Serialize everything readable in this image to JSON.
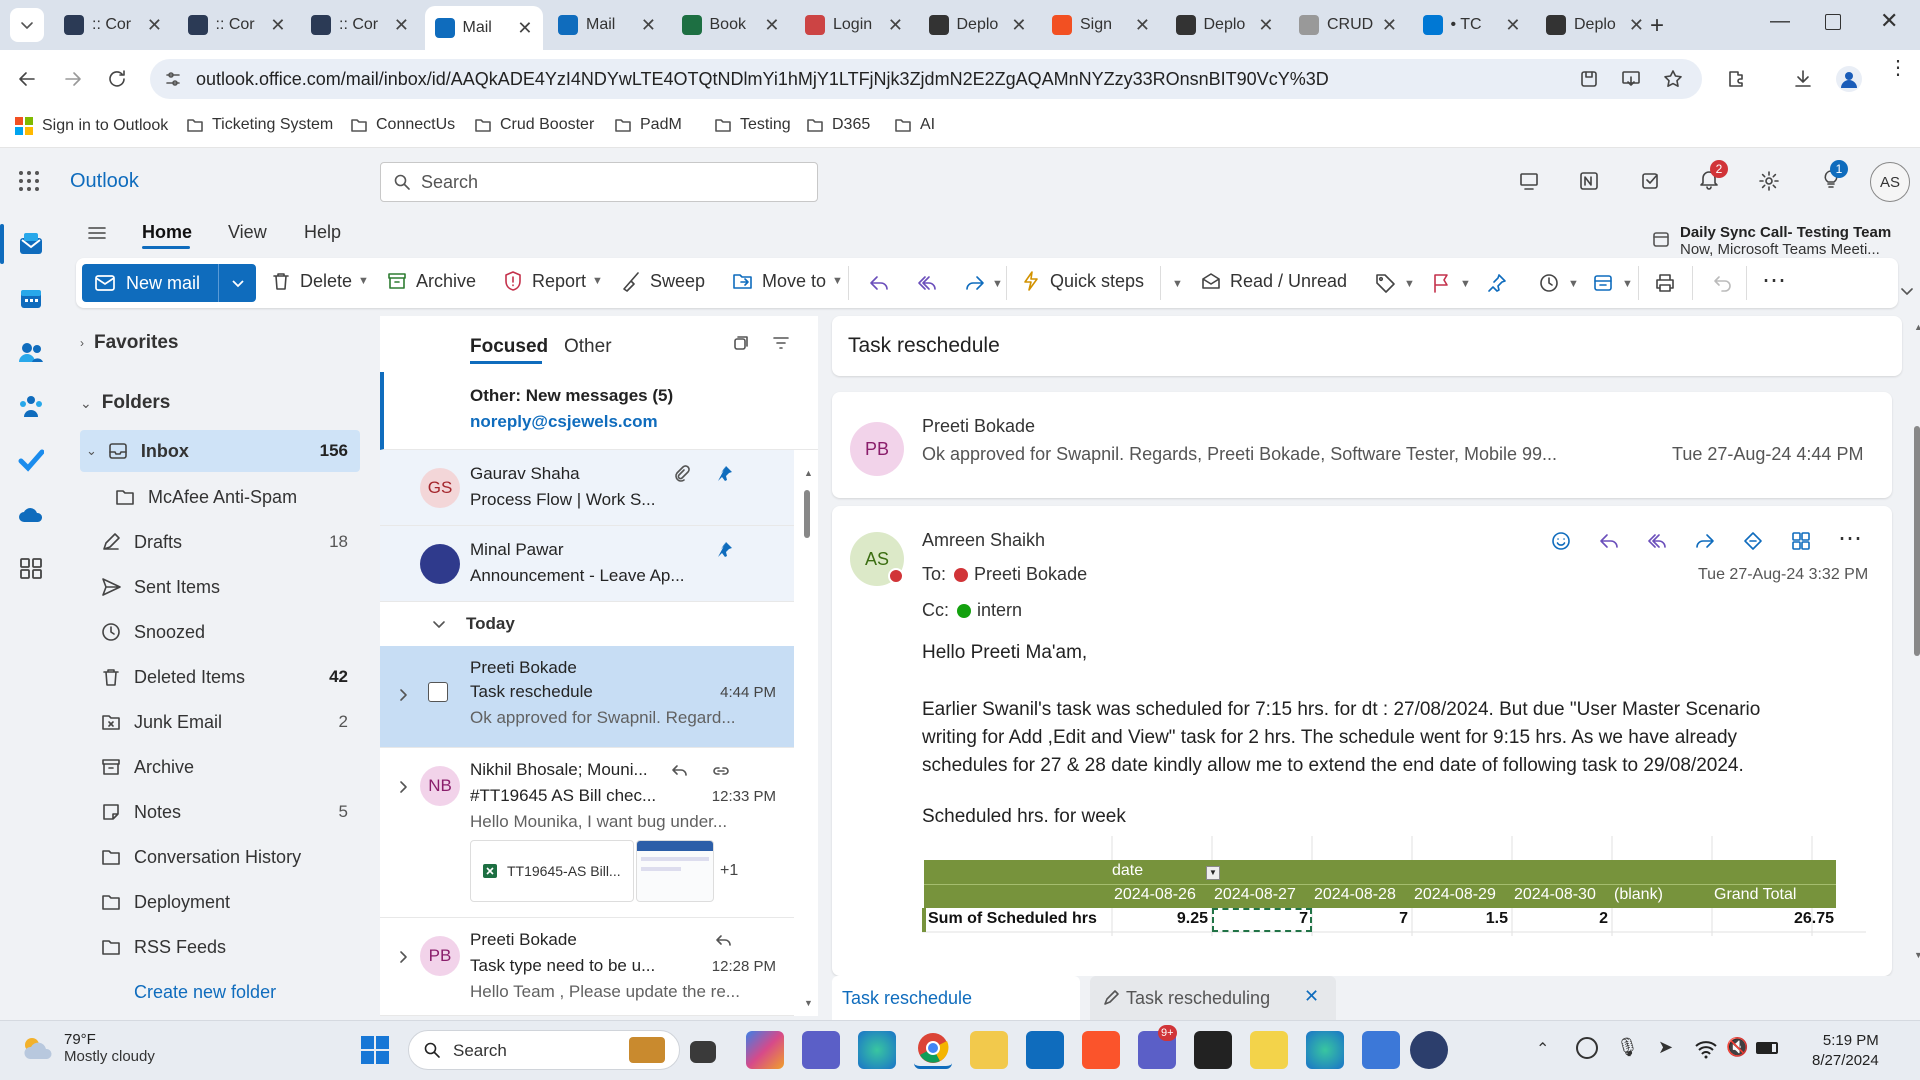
{
  "browser": {
    "tabs": [
      {
        "title": ":: Cor",
        "color": "#2b3a55"
      },
      {
        "title": ":: Cor",
        "color": "#2b3a55"
      },
      {
        "title": ":: Cor",
        "color": "#2b3a55"
      },
      {
        "title": "Mail",
        "color": "#0f6cbd",
        "active": true
      },
      {
        "title": "Mail",
        "color": "#0f6cbd"
      },
      {
        "title": "Book",
        "color": "#1d6f42"
      },
      {
        "title": "Login",
        "color": "#c44"
      },
      {
        "title": "Deplo",
        "color": "#333"
      },
      {
        "title": "Sign",
        "color": "#f25022"
      },
      {
        "title": "Deplo",
        "color": "#333"
      },
      {
        "title": "CRUD",
        "color": "#999"
      },
      {
        "title": "• TC",
        "color": "#0078d4"
      },
      {
        "title": "Deplo",
        "color": "#333"
      }
    ],
    "url": "outlook.office.com/mail/inbox/id/AAQkADE4YzI4NDYwLTE4OTQtNDlmYi1hMjY1LTFjNjk3ZjdmN2E2ZgAQAMnNYZzy33ROnsnBIT90VcY%3D",
    "bookmarks": [
      "Sign in to Outlook",
      "Ticketing System",
      "ConnectUs",
      "Crud Booster",
      "PadM",
      "Testing",
      "D365",
      "AI"
    ]
  },
  "outlook": {
    "app_name": "Outlook",
    "search_placeholder": "Search",
    "notifications_badge": "2",
    "tips_badge": "1",
    "user_initials": "AS",
    "ribbon_tabs": [
      "Home",
      "View",
      "Help"
    ],
    "meeting": {
      "title": "Daily Sync Call- Testing Team",
      "subtitle": "Now, Microsoft Teams Meeti..."
    },
    "actions": {
      "new_mail": "New mail",
      "delete": "Delete",
      "archive": "Archive",
      "report": "Report",
      "sweep": "Sweep",
      "move_to": "Move to",
      "quick_steps": "Quick steps",
      "read_unread": "Read / Unread"
    }
  },
  "folders": {
    "favorites_label": "Favorites",
    "folders_label": "Folders",
    "items": [
      {
        "name": "Inbox",
        "count": "156",
        "bold": true
      },
      {
        "name": "McAfee Anti-Spam",
        "count": ""
      },
      {
        "name": "Drafts",
        "count": "18"
      },
      {
        "name": "Sent Items",
        "count": ""
      },
      {
        "name": "Snoozed",
        "count": ""
      },
      {
        "name": "Deleted Items",
        "count": "42",
        "bold_count": true
      },
      {
        "name": "Junk Email",
        "count": "2"
      },
      {
        "name": "Archive",
        "count": ""
      },
      {
        "name": "Notes",
        "count": "5"
      },
      {
        "name": "Conversation History",
        "count": ""
      },
      {
        "name": "Deployment",
        "count": ""
      },
      {
        "name": "RSS Feeds",
        "count": ""
      }
    ],
    "create_new": "Create new folder"
  },
  "message_list": {
    "tab_focused": "Focused",
    "tab_other": "Other",
    "other_banner": {
      "title": "Other: New messages (5)",
      "sender": "noreply@csjewels.com"
    },
    "pinned": [
      {
        "initials": "GS",
        "from": "Gaurav Shaha",
        "subject": "Process Flow | Work S..."
      },
      {
        "initials": "",
        "from": "Minal Pawar",
        "subject": "Announcement - Leave Ap..."
      }
    ],
    "group_today": "Today",
    "messages": [
      {
        "from": "Preeti Bokade",
        "subject": "Task reschedule",
        "time": "4:44 PM",
        "preview": "Ok approved for Swapnil. Regard..."
      },
      {
        "initials": "NB",
        "from": "Nikhil Bhosale; Mouni...",
        "subject": "#TT19645 AS Bill chec...",
        "time": "12:33 PM",
        "preview": "Hello Mounika, I want bug under...",
        "attachment": "TT19645-AS Bill...",
        "more": "+1"
      },
      {
        "initials": "PB",
        "from": "Preeti Bokade",
        "subject": "Task type need to be u...",
        "time": "12:28 PM",
        "preview": "Hello Team , Please update the re..."
      }
    ]
  },
  "reading": {
    "subject": "Task reschedule",
    "reply1": {
      "initials": "PB",
      "from": "Preeti Bokade",
      "preview": "Ok approved for Swapnil. Regards, Preeti Bokade, Software Tester, Mobile 99...",
      "date": "Tue 27-Aug-24 4:44 PM"
    },
    "mail": {
      "initials": "AS",
      "from": "Amreen Shaikh",
      "to_label": "To:",
      "to": "Preeti Bokade",
      "cc_label": "Cc:",
      "cc": "intern",
      "date": "Tue 27-Aug-24 3:32 PM",
      "greeting": "Hello Preeti Ma'am,",
      "body_lines": [
        "Earlier Swanil's task was scheduled for 7:15 hrs. for dt : 27/08/2024. But due \"User Master Scenario",
        "writing for Add ,Edit and View\" task for 2 hrs. The schedule went for 9:15 hrs. As we have already",
        "schedules for 27 & 28 date kindly allow me to extend the end date of following task to 29/08/2024."
      ],
      "table_caption": "Scheduled hrs. for week",
      "table": {
        "field": "date",
        "headers": [
          "2024-08-26",
          "2024-08-27",
          "2024-08-28",
          "2024-08-29",
          "2024-08-30",
          "(blank)",
          "Grand Total"
        ],
        "row_label": "Sum of Scheduled hrs",
        "values": [
          "9.25",
          "7",
          "7",
          "1.5",
          "2",
          "",
          "26.75"
        ]
      }
    }
  },
  "bottom_tabs": [
    "Task reschedule",
    "Task rescheduling"
  ],
  "taskbar": {
    "weather_temp": "79°F",
    "weather_desc": "Mostly cloudy",
    "search": "Search",
    "teams_badge": "9+",
    "time": "5:19 PM",
    "date": "8/27/2024"
  }
}
